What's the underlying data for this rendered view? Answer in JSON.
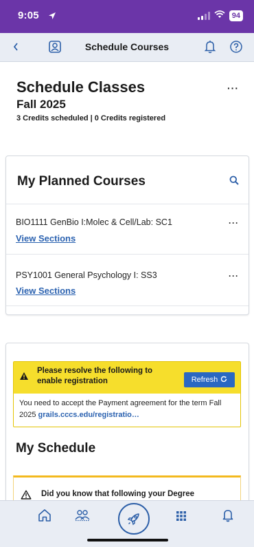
{
  "status_bar": {
    "time": "9:05",
    "battery": "94"
  },
  "nav": {
    "title": "Schedule Courses"
  },
  "header": {
    "title": "Schedule Classes",
    "term": "Fall 2025",
    "credits": "3 Credits scheduled | 0 Credits registered",
    "more": "···"
  },
  "planned": {
    "title": "My Planned Courses",
    "courses": [
      {
        "name": "BIO1111 GenBio I:Molec & Cell/Lab: SC1",
        "link": "View Sections",
        "more": "···"
      },
      {
        "name": "PSY1001 General Psychology I: SS3",
        "link": "View Sections",
        "more": "···"
      }
    ]
  },
  "registration_alert": {
    "title": "Please resolve the following to enable registration",
    "refresh_label": "Refresh",
    "message": "You need to accept the Payment agreement for the term Fall 2025",
    "link": "grails.cccs.edu/registratio…"
  },
  "schedule": {
    "title": "My Schedule"
  },
  "info_banner": {
    "text": "Did you know that following your Degree"
  },
  "colors": {
    "status_bar": "#6b35a8",
    "accent": "#2c5fa8",
    "alert_yellow": "#f6de2c",
    "refresh_blue": "#2a68c2"
  },
  "bottom_nav": [
    "home-icon",
    "people-icon",
    "rocket-icon",
    "grid-icon",
    "bell-icon"
  ]
}
